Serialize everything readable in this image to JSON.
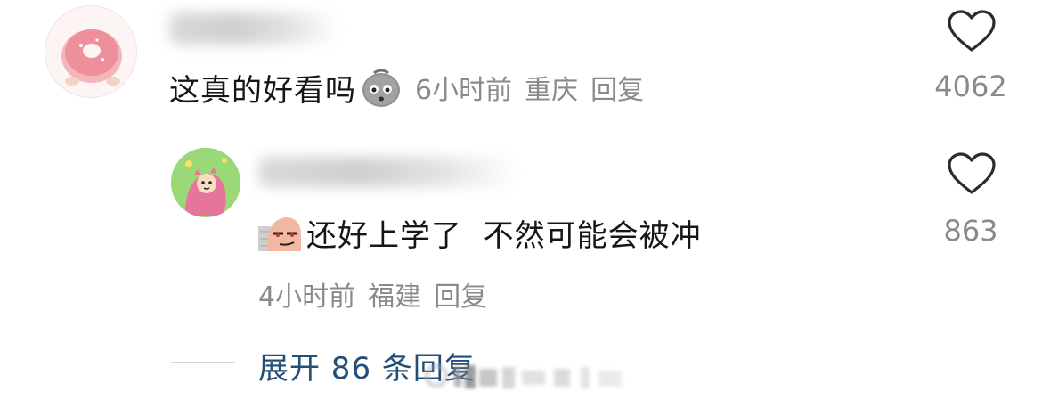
{
  "comment": {
    "text": "这真的好看吗",
    "time": "6小时前",
    "location": "重庆",
    "reply_label": "回复",
    "like_count": "4062",
    "emoji_icon": "sad-potato-emoji-icon"
  },
  "reply": {
    "text": "还好上学了  不然可能会被冲",
    "time": "4小时前",
    "location": "福建",
    "reply_label": "回复",
    "like_count": "863",
    "emoji_icon": "smirk-face-emoji-icon"
  },
  "expand": {
    "label": "展开 86 条回复"
  },
  "colors": {
    "text": "#161616",
    "meta": "#8a8a8a",
    "link": "#244e7a",
    "heart_stroke": "#2b2b2b"
  }
}
